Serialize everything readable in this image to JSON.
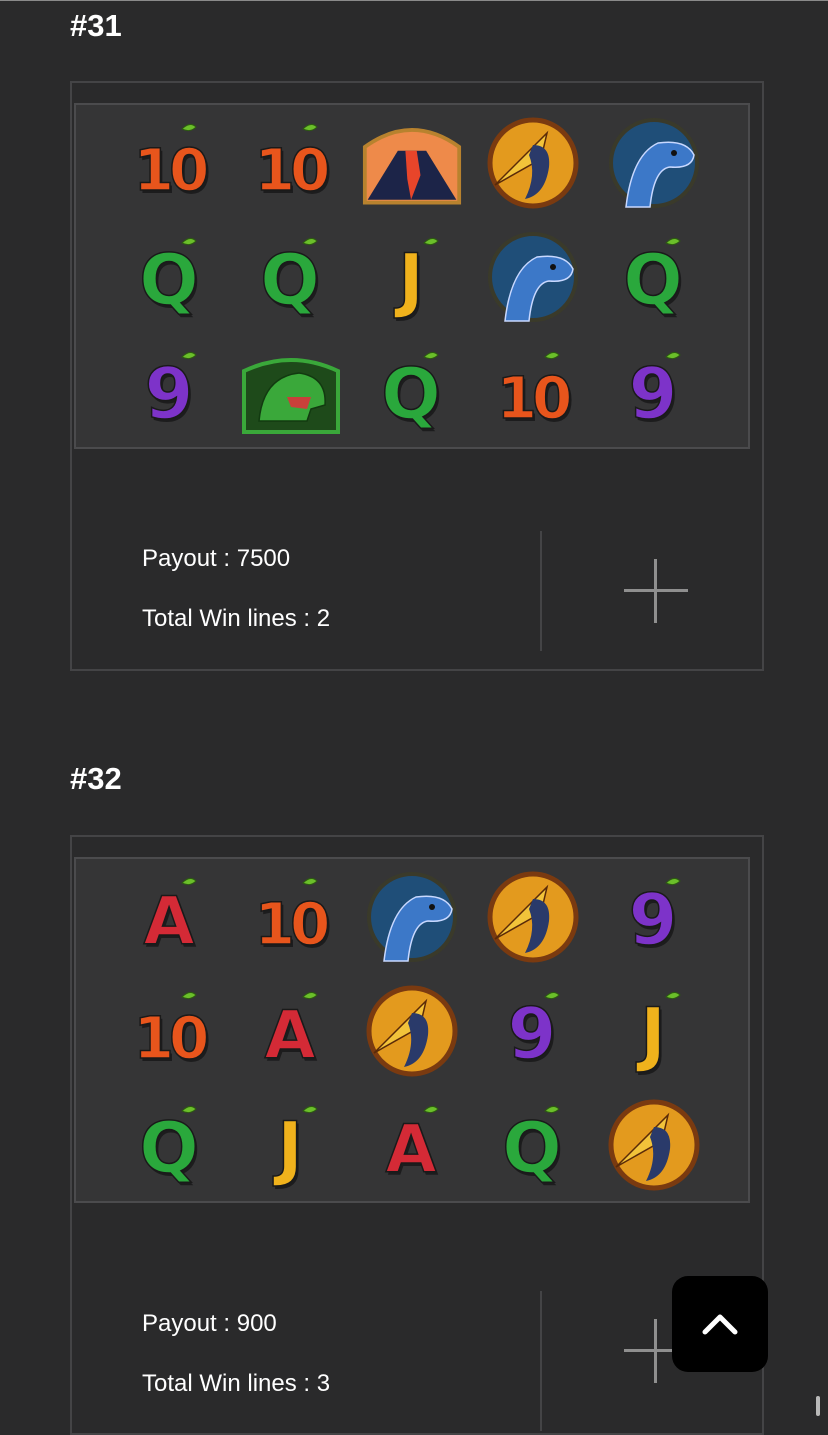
{
  "spins": [
    {
      "title": "#31",
      "grid": [
        [
          "ten",
          "ten",
          "volcano",
          "pterodactyl",
          "brachiosaurus"
        ],
        [
          "queen",
          "queen",
          "jack",
          "brachiosaurus",
          "queen"
        ],
        [
          "nine",
          "t-rex",
          "queen",
          "ten",
          "nine"
        ]
      ],
      "payout_label": "Payout : 7500",
      "win_lines_label": "Total Win lines : 2"
    },
    {
      "title": "#32",
      "grid": [
        [
          "ace",
          "ten",
          "brachiosaurus",
          "pterodactyl",
          "nine"
        ],
        [
          "ten",
          "ace",
          "pterodactyl",
          "nine",
          "jack"
        ],
        [
          "queen",
          "jack",
          "ace",
          "queen",
          "pterodactyl"
        ]
      ],
      "payout_label": "Payout : 900",
      "win_lines_label": "Total Win lines : 3"
    }
  ],
  "symbol_glyphs": {
    "ten": "10",
    "queen": "Q",
    "jack": "J",
    "nine": "9",
    "ace": "A"
  },
  "icons": {
    "expand": "plus-icon",
    "scroll_top": "chevron-up-icon"
  },
  "colors": {
    "background": "#2a2a2b",
    "card_border": "#444446",
    "grid_background": "#353536",
    "text": "#ffffff",
    "ten": "#e8551c",
    "queen": "#2aa83c",
    "jack": "#f0b21c",
    "nine": "#7d33c9",
    "ace": "#d42a36",
    "volcano_sky": "#ee8a4a",
    "brachiosaurus": "#3c78c8",
    "pterodactyl": "#c46a1a",
    "t_rex": "#3aa83a"
  }
}
